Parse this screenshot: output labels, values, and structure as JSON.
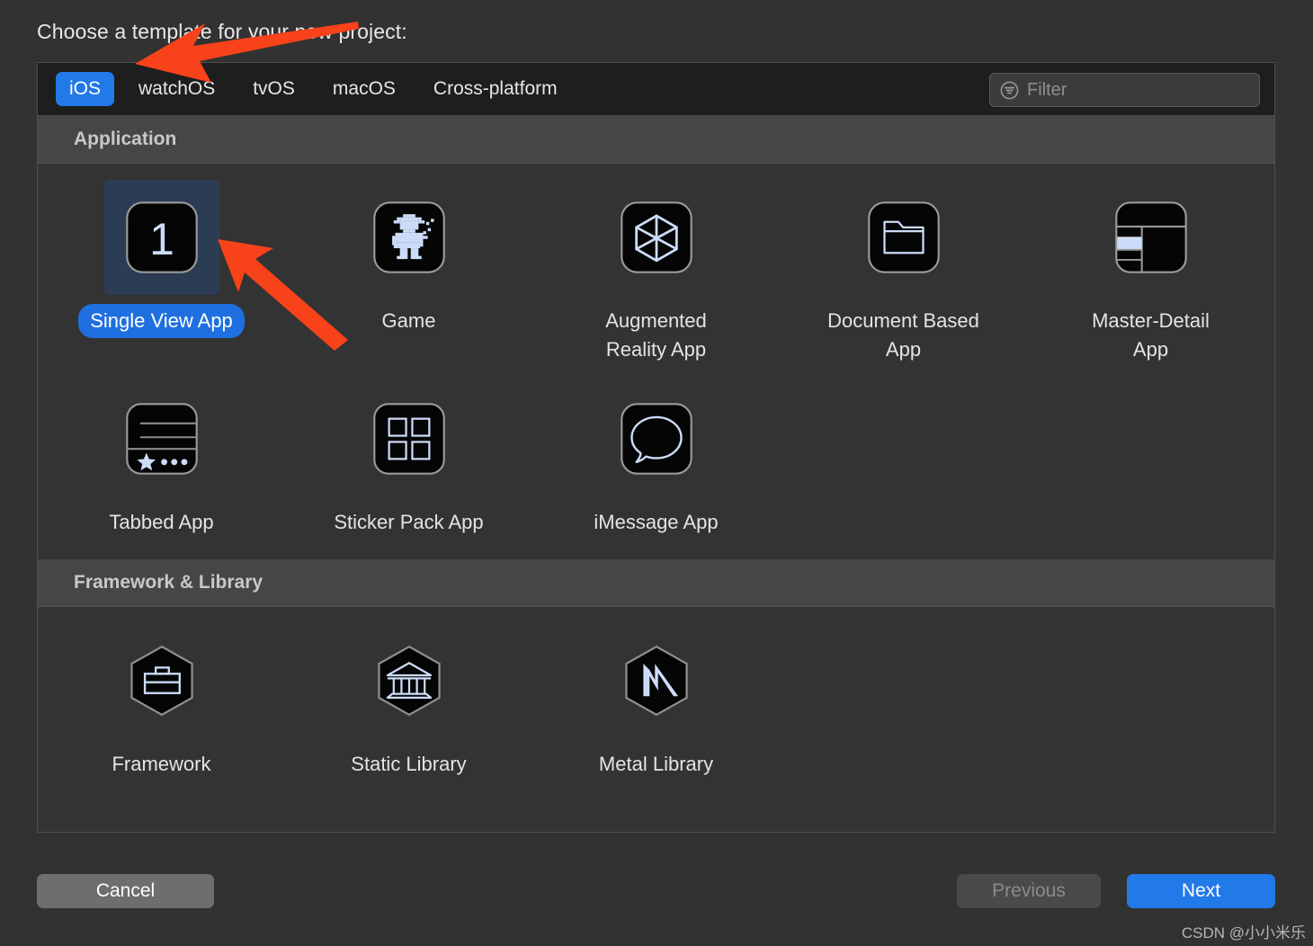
{
  "dialog": {
    "title": "Choose a template for your new project:"
  },
  "tabs": [
    {
      "label": "iOS",
      "active": true
    },
    {
      "label": "watchOS",
      "active": false
    },
    {
      "label": "tvOS",
      "active": false
    },
    {
      "label": "macOS",
      "active": false
    },
    {
      "label": "Cross-platform",
      "active": false
    }
  ],
  "filter": {
    "placeholder": "Filter",
    "value": "",
    "icon": "filter-icon"
  },
  "sections": [
    {
      "header": "Application",
      "templates": [
        {
          "label": "Single View App",
          "icon": "number-one-icon",
          "selected": true
        },
        {
          "label": "Game",
          "icon": "robot-sprite-icon",
          "selected": false
        },
        {
          "label": "Augmented Reality App",
          "icon": "cube-wireframe-icon",
          "selected": false
        },
        {
          "label": "Document Based App",
          "icon": "folder-icon",
          "selected": false
        },
        {
          "label": "Master-Detail App",
          "icon": "split-view-icon",
          "selected": false
        },
        {
          "label": "Tabbed App",
          "icon": "tab-bar-icon",
          "selected": false
        },
        {
          "label": "Sticker Pack App",
          "icon": "grid-four-icon",
          "selected": false
        },
        {
          "label": "iMessage App",
          "icon": "speech-bubble-icon",
          "selected": false
        }
      ]
    },
    {
      "header": "Framework & Library",
      "templates": [
        {
          "label": "Framework",
          "icon": "toolbox-hexagon-icon",
          "selected": false
        },
        {
          "label": "Static Library",
          "icon": "bank-hexagon-icon",
          "selected": false
        },
        {
          "label": "Metal Library",
          "icon": "metal-m-hexagon-icon",
          "selected": false
        }
      ]
    }
  ],
  "footer": {
    "cancel": "Cancel",
    "previous": "Previous",
    "next": "Next"
  },
  "annotations": {
    "arrow_color": "#f8421a",
    "arrow_1_target": "iOS tab",
    "arrow_2_target": "Single View App template"
  },
  "watermark": "CSDN @小小米乐",
  "colors": {
    "accent_blue": "#2279e8",
    "selection_blue": "#1f6fe0",
    "panel_bg": "#333333",
    "tabbar_bg": "#1e1e1e",
    "section_header_bg": "#464646",
    "icon_tint": "#ccdcf8"
  }
}
